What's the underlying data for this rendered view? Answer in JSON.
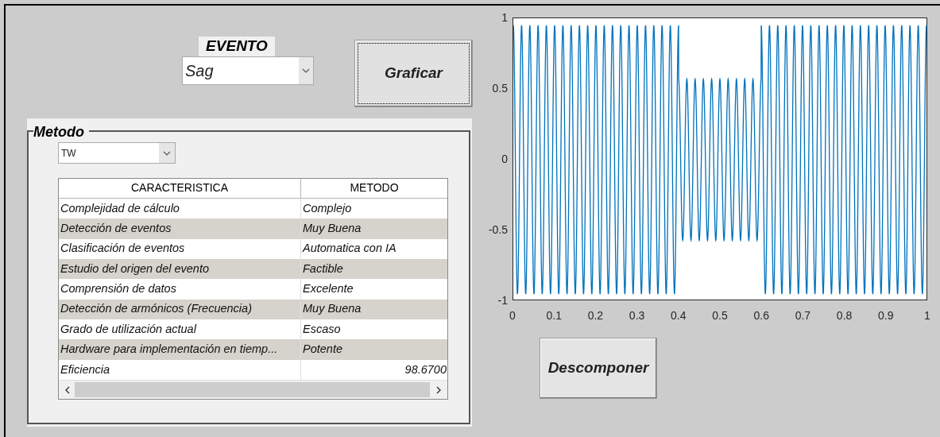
{
  "evento": {
    "label": "EVENTO",
    "value": "Sag"
  },
  "graficar_button": "Graficar",
  "metodo": {
    "title": "Metodo",
    "value": "TW",
    "table": {
      "columns": [
        "CARACTERISTICA",
        "METODO"
      ],
      "rows": [
        {
          "cells": [
            "Complejidad de cálculo",
            "Complejo"
          ]
        },
        {
          "cells": [
            "Detección de eventos",
            "Muy Buena"
          ]
        },
        {
          "cells": [
            "Clasificación de eventos",
            "Automatica con IA"
          ]
        },
        {
          "cells": [
            "Estudio del origen del evento",
            "Factible"
          ]
        },
        {
          "cells": [
            "Comprensión de datos",
            "Excelente"
          ]
        },
        {
          "cells": [
            "Detección de armónicos (Frecuencia)",
            "Muy Buena"
          ]
        },
        {
          "cells": [
            "Grado de utilización actual",
            "Escaso"
          ]
        },
        {
          "cells": [
            "Hardware para implementación en tiemp...",
            "Potente"
          ]
        },
        {
          "cells": [
            "Eficiencia",
            "98.6700"
          ],
          "kind": "numeric"
        }
      ]
    }
  },
  "plot": {
    "yticks": [
      "1",
      "0.5",
      "0",
      "-0.5",
      "-1"
    ],
    "xticks": [
      "0",
      "0.1",
      "0.2",
      "0.3",
      "0.4",
      "0.5",
      "0.6",
      "0.7",
      "0.8",
      "0.9",
      "1"
    ]
  },
  "descomponer_button": "Descomponer"
}
